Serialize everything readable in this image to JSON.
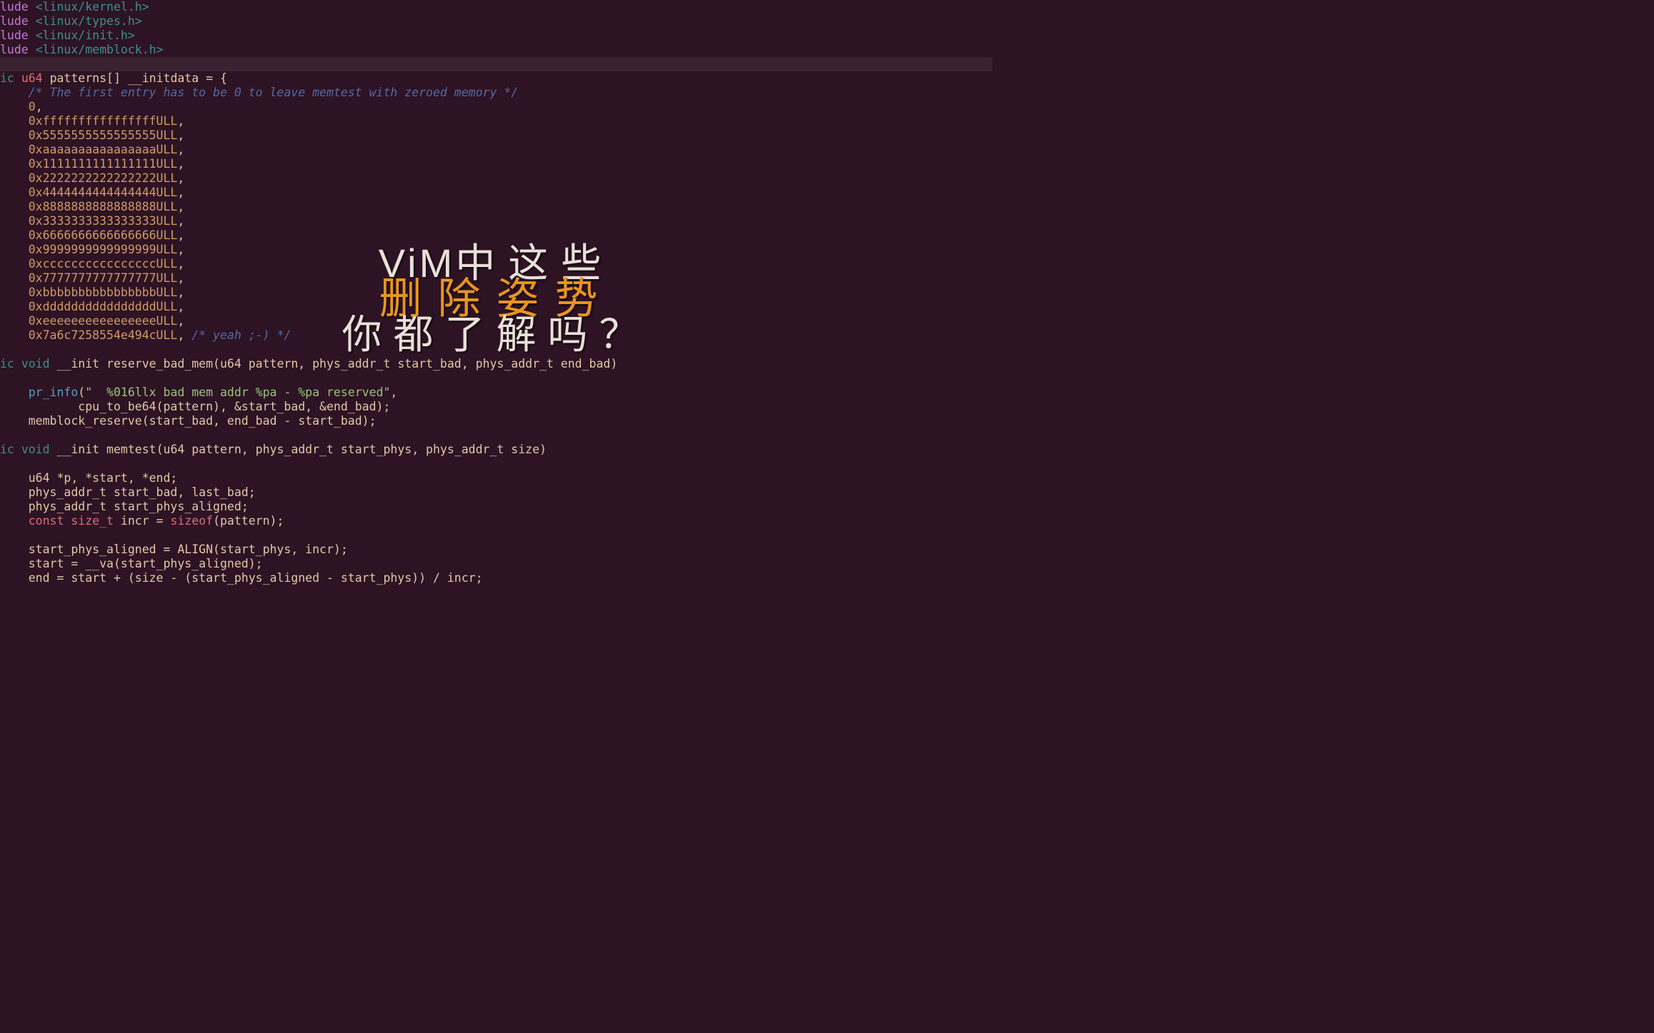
{
  "overlay": {
    "line1_prefix": "ViM",
    "line1_suffix": "中这些",
    "line2": "删除姿势",
    "line3": "你都了解吗？"
  },
  "code": {
    "includes": [
      {
        "kw": "lude",
        "header": "<linux/kernel.h>"
      },
      {
        "kw": "lude",
        "header": "<linux/types.h>"
      },
      {
        "kw": "lude",
        "header": "<linux/init.h>"
      },
      {
        "kw": "lude",
        "header": "<linux/memblock.h>"
      }
    ],
    "pattern_decl": {
      "storage": "ic",
      "type": "u64",
      "name": "patterns[]",
      "attr": "__initdata",
      "eq": "= {"
    },
    "pattern_comment": "/* The first entry has to be 0 to leave memtest with zeroed memory */",
    "pattern_first": "0",
    "patterns": [
      "0xffffffffffffffffULL",
      "0x5555555555555555ULL",
      "0xaaaaaaaaaaaaaaaaULL",
      "0x1111111111111111ULL",
      "0x2222222222222222ULL",
      "0x4444444444444444ULL",
      "0x8888888888888888ULL",
      "0x3333333333333333ULL",
      "0x6666666666666666ULL",
      "0x9999999999999999ULL",
      "0xccccccccccccccccULL",
      "0x7777777777777777ULL",
      "0xbbbbbbbbbbbbbbbbULL",
      "0xddddddddddddddddULL",
      "0xeeeeeeeeeeeeeeeeULL",
      "0x7a6c7258554e494cULL"
    ],
    "yeah_comment": "/* yeah ;-) */",
    "func1": {
      "storage": "ic",
      "ret": "void",
      "attr": "__init",
      "name": "reserve_bad_mem",
      "params": "(u64 pattern, phys_addr_t start_bad, phys_addr_t end_bad)",
      "pr_info": "pr_info",
      "pr_str": "\"  %016llx bad mem addr %pa - %pa reserved\"",
      "pr_args_line2": "cpu_to_be64(pattern), &start_bad, &end_bad);",
      "reserve": "memblock_reserve(start_bad, end_bad - start_bad);"
    },
    "func2": {
      "storage": "ic",
      "ret": "void",
      "attr": "__init",
      "name": "memtest",
      "params": "(u64 pattern, phys_addr_t start_phys, phys_addr_t size)",
      "body": [
        {
          "indent": "    ",
          "text_parts": [
            [
              "ident",
              "u64 *p, *start, *end;"
            ]
          ]
        },
        {
          "indent": "    ",
          "text_parts": [
            [
              "ident",
              "phys_addr_t start_bad, last_bad;"
            ]
          ]
        },
        {
          "indent": "    ",
          "text_parts": [
            [
              "ident",
              "phys_addr_t start_phys_aligned;"
            ]
          ]
        },
        {
          "indent": "    ",
          "text_parts": [
            [
              "type",
              "const size_t"
            ],
            [
              "ident",
              " incr = "
            ],
            [
              "type",
              "sizeof"
            ],
            [
              "ident",
              "(pattern);"
            ]
          ]
        },
        {
          "indent": "",
          "text_parts": []
        },
        {
          "indent": "    ",
          "text_parts": [
            [
              "ident",
              "start_phys_aligned = ALIGN(start_phys, incr);"
            ]
          ]
        },
        {
          "indent": "    ",
          "text_parts": [
            [
              "ident",
              "start = __va(start_phys_aligned);"
            ]
          ]
        },
        {
          "indent": "    ",
          "text_parts": [
            [
              "ident",
              "end = start + (size - (start_phys_aligned - start_phys)) / incr;"
            ]
          ]
        }
      ]
    }
  }
}
